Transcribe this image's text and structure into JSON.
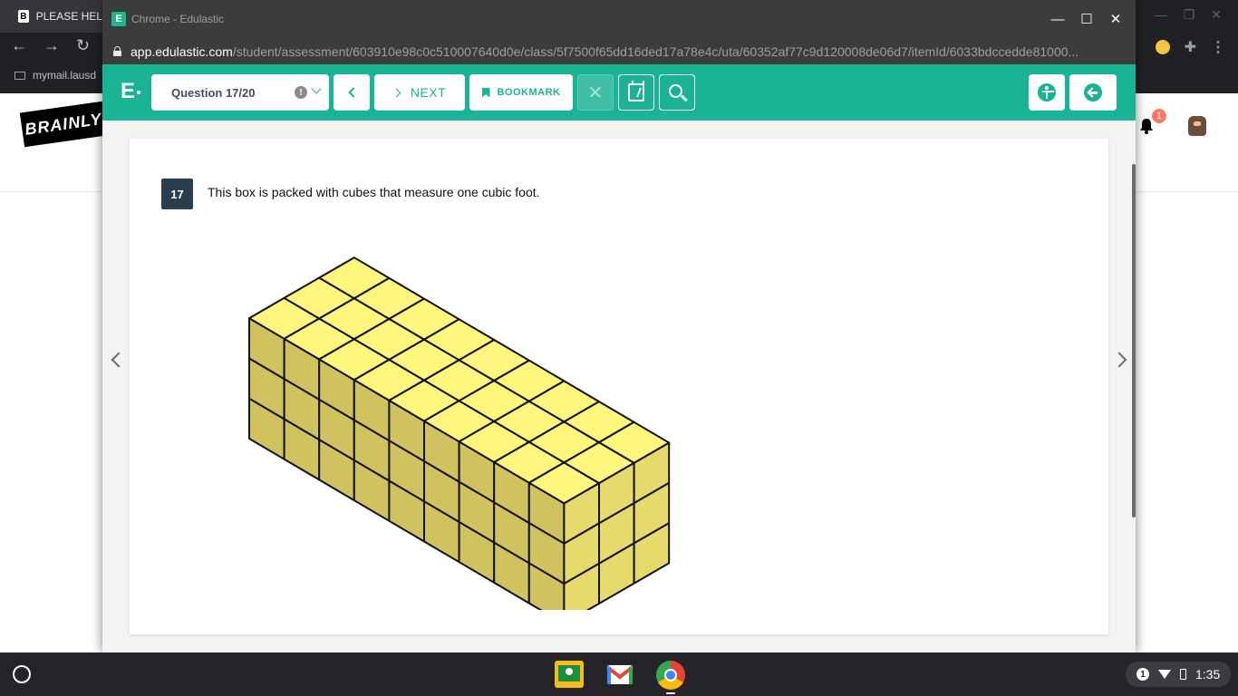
{
  "background": {
    "tab_title": "PLEASE HEL",
    "bookmark": "mymail.lausd",
    "logo_text": "BRAINLY",
    "notification_count": "1"
  },
  "window": {
    "title": "Chrome - Edulastic",
    "url_host": "app.edulastic.com",
    "url_path": "/student/assessment/603910e98c0c510007640d0e/class/5f7500f65dd16ded17a78e4c/uta/60352af77c9d120008de06d7/itemId/6033bdccedde81000..."
  },
  "toolbar": {
    "logo": "E",
    "question_select": "Question 17/20",
    "next_label": "NEXT",
    "bookmark_label": "BOOKMARK"
  },
  "question": {
    "number": "17",
    "text": "This box is packed with cubes that measure one cubic foot.",
    "figure": {
      "length_cubes": 9,
      "width_cubes": 3,
      "height_cubes": 3,
      "top_color": "#fdf57c",
      "front_color": "#d0c35f",
      "side_color": "#e6da6c",
      "edge_color": "#111111"
    }
  },
  "taskbar": {
    "time": "1:35",
    "notification_count": "1"
  },
  "colors": {
    "accent": "#1ab395",
    "qnum_bg": "#2b3e50"
  }
}
